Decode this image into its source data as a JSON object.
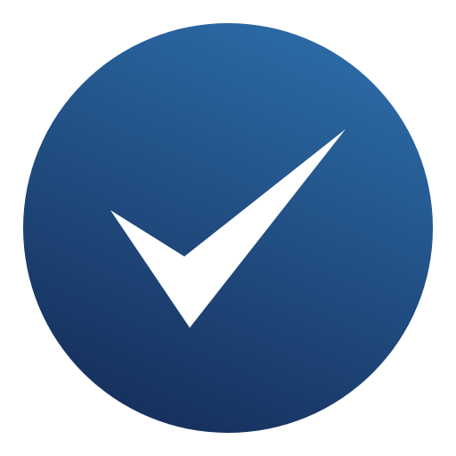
{
  "icon": {
    "name": "checkmark-circle-icon",
    "background_color": "#ffffff",
    "circle_gradient_top": "#2b6aa6",
    "circle_gradient_bottom": "#17325f",
    "check_color": "#ffffff"
  }
}
